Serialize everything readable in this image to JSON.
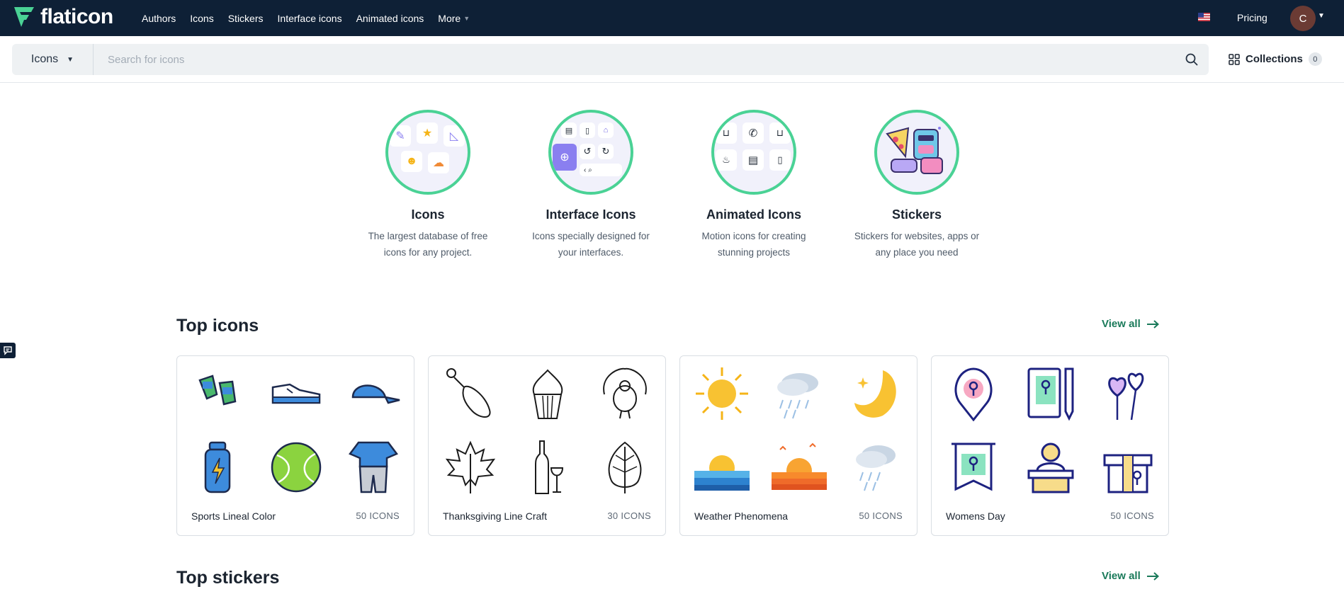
{
  "nav": {
    "logo_text": "flaticon",
    "links": [
      "Authors",
      "Icons",
      "Stickers",
      "Interface icons",
      "Animated icons"
    ],
    "more_label": "More",
    "pricing_label": "Pricing",
    "avatar_letter": "C"
  },
  "search": {
    "type_label": "Icons",
    "placeholder": "Search for icons",
    "collections_label": "Collections",
    "collections_count": "0"
  },
  "categories": [
    {
      "title": "Icons",
      "desc": "The largest database of free icons for any project."
    },
    {
      "title": "Interface Icons",
      "desc": "Icons specially designed for your interfaces."
    },
    {
      "title": "Animated Icons",
      "desc": "Motion icons for creating stunning projects"
    },
    {
      "title": "Stickers",
      "desc": "Stickers for websites, apps or any place you need"
    }
  ],
  "top_icons": {
    "title": "Top icons",
    "view_all": "View all",
    "packs": [
      {
        "name": "Sports Lineal Color",
        "count": "50 ICONS"
      },
      {
        "name": "Thanksgiving Line Craft",
        "count": "30 ICONS"
      },
      {
        "name": "Weather Phenomena",
        "count": "50 ICONS"
      },
      {
        "name": "Womens Day",
        "count": "50 ICONS"
      }
    ]
  },
  "top_stickers": {
    "title": "Top stickers",
    "view_all": "View all"
  },
  "colors": {
    "nav_bg": "#0e2036",
    "accent_green": "#4ad295",
    "link_green": "#1a7a5a",
    "search_bg": "#eef1f3"
  }
}
